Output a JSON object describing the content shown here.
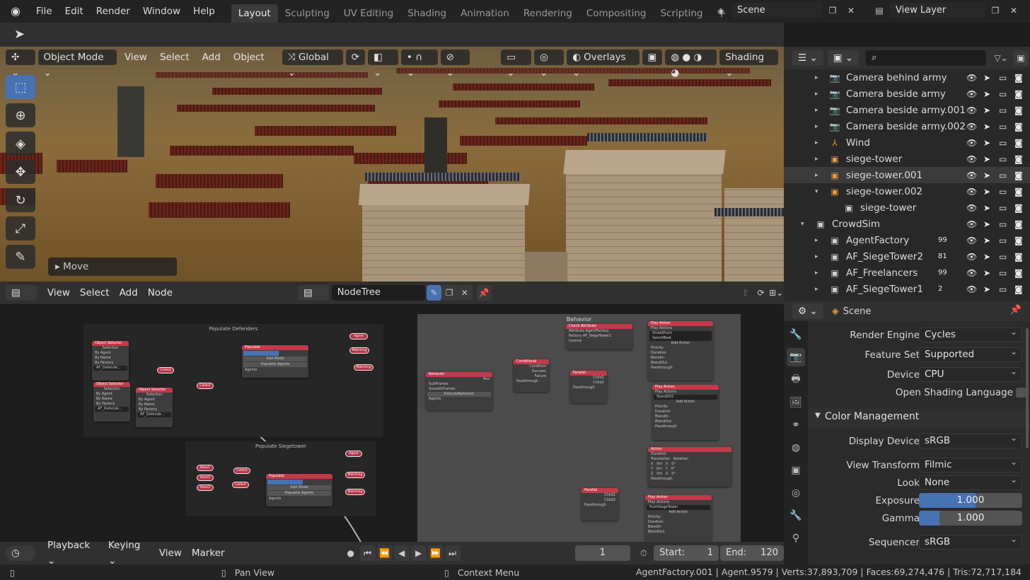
{
  "topbar": {
    "menus": [
      "File",
      "Edit",
      "Render",
      "Window",
      "Help"
    ],
    "workspaces": [
      {
        "label": "Layout",
        "active": true
      },
      {
        "label": "Sculpting"
      },
      {
        "label": "UV Editing"
      },
      {
        "label": "Shading"
      },
      {
        "label": "Animation"
      },
      {
        "label": "Rendering"
      },
      {
        "label": "Compositing"
      },
      {
        "label": "Scripting"
      }
    ],
    "add_workspace": "+",
    "scene": "Scene",
    "view_layer": "View Layer"
  },
  "viewport": {
    "mode": "Object Mode",
    "menus": [
      "View",
      "Select",
      "Add",
      "Object"
    ],
    "orientation": "Global",
    "overlays": "Overlays",
    "shading": "Shading",
    "last_op": "Move"
  },
  "node_editor": {
    "menus": [
      "View",
      "Select",
      "Add",
      "Node"
    ],
    "tree_name": "NodeTree",
    "frames": {
      "populate_defenders": "Populate Defenders",
      "populate_siegetower": "Populate Siegetower",
      "behavior": "Behavior"
    },
    "nodes": {
      "obj_sel": "Object Selector",
      "selection": "Selection",
      "by_agent": "By Agent",
      "by_name": "By Name",
      "by_factory": "By Factory",
      "af_defenders": "AF_Defende...",
      "collect": "Collect",
      "populate": "Populate",
      "add_mode": "Add Mode",
      "populate_agents": "Populate Agents",
      "agents": "Agents",
      "agent": "Agent",
      "matching": "Matching",
      "match": "Matching",
      "base1": "Base1",
      "base2": "Base2",
      "base3": "Base3",
      "behavior": "Behavior",
      "sub_frames": "SubFrames",
      "smooth_frames": "SmoothFrames",
      "execute": "ExecuteBehavior",
      "condition": "Condition",
      "success": "Success",
      "failure": "Failure",
      "passthrough": "Passthrough",
      "check_attr": "Check Attribute",
      "attribute": "Attribute",
      "agent_factory": "AgentFactory",
      "factory": "Factory",
      "af_siege": "AF_SiegeTower2",
      "inverse": "Inverse",
      "parallel": "Parallel",
      "child1": "Child1",
      "child2": "Child2",
      "play_action": "Play Action",
      "play_actions": "Play Actions",
      "shield_front": "ShieldFront",
      "sword_beat": "SwordBeat",
      "add_action": "Add Action",
      "priority": "Priority",
      "duration": "Duration",
      "blend_in": "BlendIn",
      "blend_out": "BlendOut",
      "stand": "Stand003",
      "action": "Action",
      "translation": "Translation",
      "rotation": "Rotation",
      "push_siege": "PushSiegeTower",
      "conditional": "Conditional"
    }
  },
  "timeline": {
    "menus": [
      "Playback",
      "Keying",
      "View",
      "Marker"
    ],
    "current_frame": "1",
    "start_label": "Start:",
    "start": "1",
    "end_label": "End:",
    "end": "120"
  },
  "status": {
    "pan": "Pan View",
    "context": "Context Menu",
    "stats": "AgentFactory.001 | Agent.9579 | Verts:37,893,709 | Faces:69,274,476 | Tris:72,717,184"
  },
  "outliner": {
    "rows": [
      {
        "label": "Camera behind army",
        "icon": "camera-icon",
        "color": "#e89a3a"
      },
      {
        "label": "Camera beside army",
        "icon": "camera-icon",
        "color": "#e89a3a"
      },
      {
        "label": "Camera beside army.001",
        "icon": "camera-icon",
        "color": "#e89a3a"
      },
      {
        "label": "Camera beside army.002",
        "icon": "camera-icon",
        "color": "#e89a3a"
      },
      {
        "label": "Wind",
        "icon": "forcefield-icon",
        "color": "#e89a3a"
      },
      {
        "label": "siege-tower",
        "icon": "empty-icon",
        "color": "#e89a3a"
      },
      {
        "label": "siege-tower.001",
        "icon": "empty-icon",
        "color": "#e89a3a"
      },
      {
        "label": "siege-tower.002",
        "icon": "empty-icon",
        "color": "#e89a3a"
      },
      {
        "label": "siege-tower",
        "icon": "collection-instance-icon",
        "color": "#d0d0d0"
      },
      {
        "label": "CrowdSim",
        "icon": "collection-icon",
        "color": "#d0d0d0"
      },
      {
        "label": "AgentFactory",
        "icon": "collection-icon",
        "color": "#d0d0d0",
        "badge": "99"
      },
      {
        "label": "AF_SiegeTower2",
        "icon": "collection-icon",
        "color": "#d0d0d0",
        "badge": "81"
      },
      {
        "label": "AF_Freelancers",
        "icon": "collection-icon",
        "color": "#d0d0d0",
        "badge": "99"
      },
      {
        "label": "AF_SiegeTower1",
        "icon": "collection-icon",
        "color": "#d0d0d0",
        "badge": "2"
      }
    ]
  },
  "properties": {
    "context": "Scene",
    "render_engine_label": "Render Engine",
    "render_engine": "Cycles",
    "feature_set_label": "Feature Set",
    "feature_set": "Supported",
    "device_label": "Device",
    "device": "CPU",
    "osl_label": "Open Shading Language",
    "color_mgmt": "Color Management",
    "display_device_label": "Display Device",
    "display_device": "sRGB",
    "view_transform_label": "View Transform",
    "view_transform": "Filmic",
    "look_label": "Look",
    "look": "None",
    "exposure_label": "Exposure",
    "exposure": "1.000",
    "gamma_label": "Gamma",
    "gamma": "1.000",
    "sequencer_label": "Sequencer",
    "sequencer": "sRGB"
  },
  "colors": {
    "accent": "#4772b3",
    "node_header": "#c23a4a",
    "outliner_object": "#e89a3a"
  }
}
